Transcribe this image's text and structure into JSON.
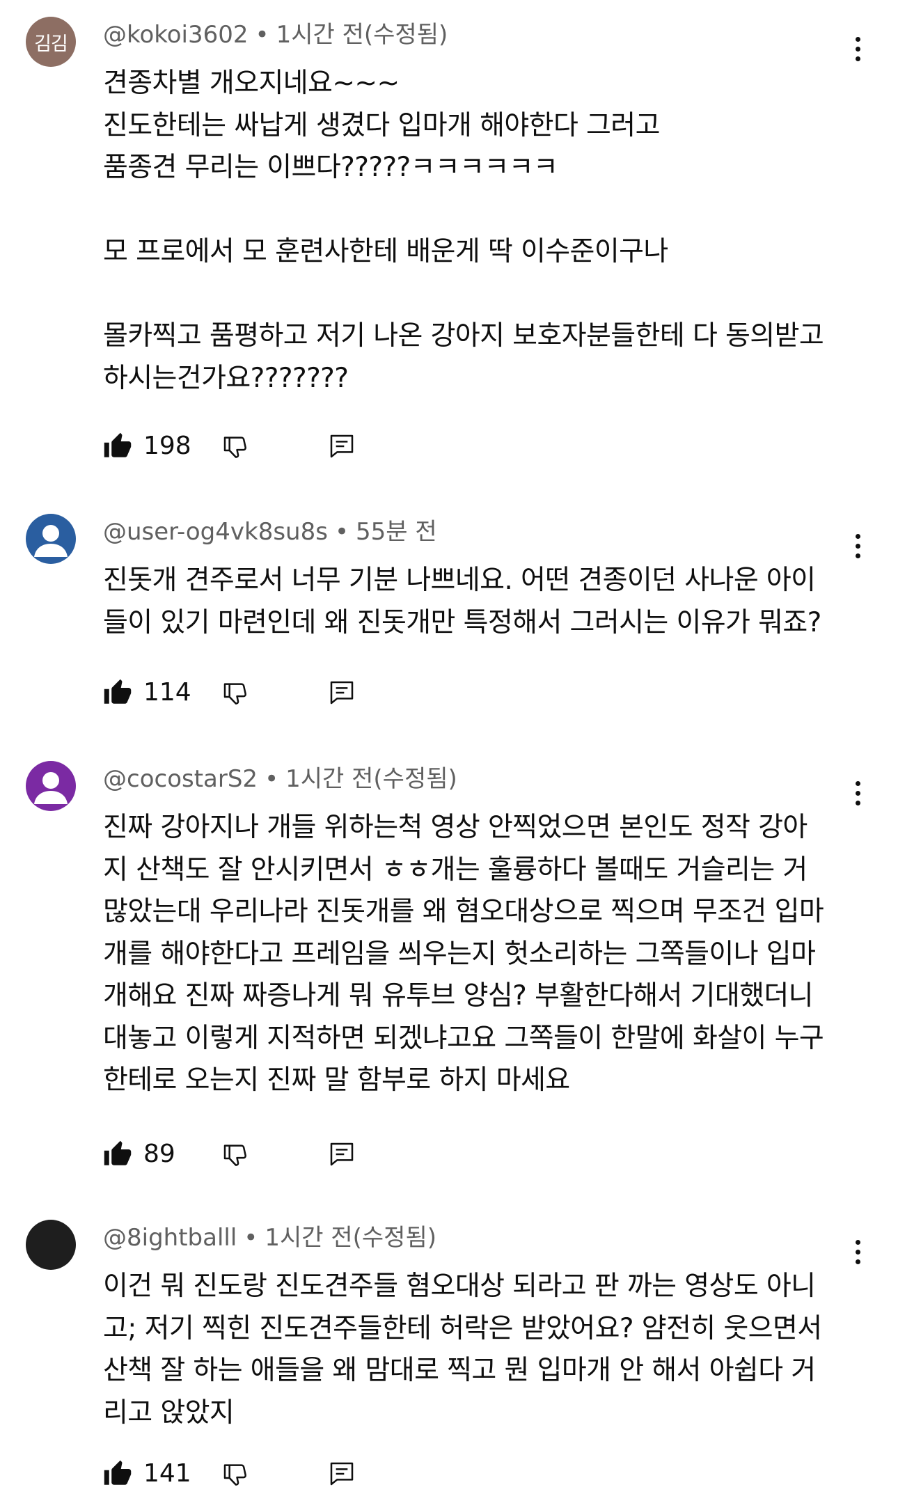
{
  "comments": [
    {
      "avatar": {
        "type": "text",
        "text": "김김",
        "color": "#8d6e63"
      },
      "handle": "@kokoi3602",
      "time": "1시간 전(수정됨)",
      "text": "견종차별 개오지네요~~~\n진도한테는 싸납게 생겼다 입마개 해야한다 그러고\n품종견 무리는 이쁘다?????ㅋㅋㅋㅋㅋㅋ\n\n모 프로에서 모 훈련사한테 배운게 딱 이수준이구나\n\n몰카찍고 품평하고 저기 나온 강아지 보호자분들한테 다 동의받고\n하시는건가요???????",
      "likes": "198"
    },
    {
      "avatar": {
        "type": "person",
        "color": "#2a5ea0"
      },
      "handle": "@user-og4vk8su8s",
      "time": "55분 전",
      "text": "진돗개 견주로서 너무 기분 나쁘네요. 어떤 견종이던 사나운 아이\n들이 있기 마련인데 왜 진돗개만 특정해서 그러시는 이유가 뭐죠?",
      "likes": "114"
    },
    {
      "avatar": {
        "type": "person",
        "color": "#7b2aa3"
      },
      "handle": "@cocostarS2",
      "time": "1시간 전(수정됨)",
      "text": "진짜 강아지나 개들 위하는척 영상 안찍었으면 본인도 정작 강아\n지 산책도 잘 안시키면서 ㅎㅎ개는 훌륭하다 볼때도 거슬리는 거\n많았는대 우리나라 진돗개를 왜 혐오대상으로 찍으며 무조건 입마\n개를 해야한다고 프레임을 씌우는지 헛소리하는 그쪽들이나 입마\n개해요 진짜 짜증나게 뭐 유투브 양심? 부활한다해서 기대했더니\n대놓고 이렇게 지적하면 되겠냐고요 그쪽들이 한말에 화살이 누구\n한테로 오는지 진짜 말 함부로 하지 마세요",
      "likes": "89"
    },
    {
      "avatar": {
        "type": "plain",
        "color": "#1e1e1e"
      },
      "handle": "@8ightballl",
      "time": "1시간 전(수정됨)",
      "text": "이건 뭐 진도랑 진도견주들 혐오대상 되라고 판 까는 영상도 아니\n고; 저기 찍힌 진도견주들한테 허락은 받았어요? 얌전히 웃으면서\n산책 잘 하는 애들을 왜 맘대로 찍고 뭔 입마개 안 해서 아쉽다 거\n리고 앉았지",
      "likes": "141"
    }
  ]
}
